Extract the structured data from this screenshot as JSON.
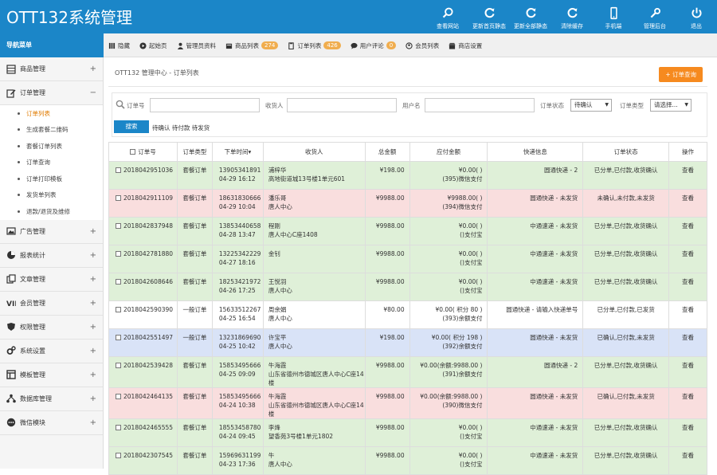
{
  "app": {
    "title": "OTT132系统管理"
  },
  "colors": {
    "primary": "#1b86c8",
    "accent": "#f68a1f",
    "row_green": "#dff0d8",
    "row_red": "#f9dede",
    "row_blue": "#d9e3f7"
  },
  "toolbar": [
    {
      "label": "查看网站",
      "icon": "search-icon"
    },
    {
      "label": "更新首页静态",
      "icon": "refresh-icon"
    },
    {
      "label": "更新全部静态",
      "icon": "refresh-icon"
    },
    {
      "label": "清除缓存",
      "icon": "refresh-icon"
    },
    {
      "label": "手机端",
      "icon": "phone-icon"
    },
    {
      "label": "管理后台",
      "icon": "wrench-icon"
    },
    {
      "label": "退出",
      "icon": "power-icon"
    }
  ],
  "nav": {
    "menu_title": "导航菜单",
    "items": [
      {
        "label": "隐藏",
        "icon": "bars-icon"
      },
      {
        "label": "起始页",
        "icon": "play-icon"
      },
      {
        "label": "管理员资料",
        "icon": "user-icon"
      },
      {
        "label": "商品列表",
        "icon": "box-icon",
        "badge": "274"
      },
      {
        "label": "订单列表",
        "icon": "clipboard-icon",
        "badge": "426"
      },
      {
        "label": "用户评论",
        "icon": "comment-icon",
        "badge": "0"
      },
      {
        "label": "会员列表",
        "icon": "users-icon"
      },
      {
        "label": "商店设置",
        "icon": "shop-icon"
      }
    ]
  },
  "sidebar": {
    "groups": [
      {
        "label": "商品管理",
        "icon": "grid-icon",
        "toggle": "+"
      },
      {
        "label": "订单管理",
        "icon": "edit-icon",
        "toggle": "−"
      }
    ],
    "subitems": [
      "订单列表",
      "生成套餐二维码",
      "套餐订单列表",
      "订单查询",
      "订单打印模板",
      "发货单列表",
      "退款/退货及维修"
    ],
    "groups2": [
      {
        "label": "广告管理",
        "icon": "image-icon",
        "toggle": "+"
      },
      {
        "label": "报表统计",
        "icon": "chart-icon",
        "toggle": "+"
      },
      {
        "label": "文章管理",
        "icon": "copy-icon",
        "toggle": "+"
      },
      {
        "label": "会员管理",
        "icon": "vip-icon",
        "toggle": "+"
      },
      {
        "label": "权限管理",
        "icon": "shield-icon",
        "toggle": "+"
      },
      {
        "label": "系统设置",
        "icon": "gears-icon",
        "toggle": "+"
      },
      {
        "label": "模板管理",
        "icon": "template-icon",
        "toggle": "+"
      },
      {
        "label": "数据库管理",
        "icon": "network-icon",
        "toggle": "+"
      },
      {
        "label": "微信模块",
        "icon": "wechat-icon",
        "toggle": "+"
      }
    ]
  },
  "main": {
    "breadcrumb": "OTT132 管理中心 - 订单列表",
    "query_button": "+ 订单查询",
    "search": {
      "order_no_label": "订单号",
      "receiver_label": "收货人",
      "username_label": "用户名",
      "status_label": "订单状态",
      "status_value": "待确认",
      "type_label": "订单类型",
      "type_value": "请选择...",
      "submit": "搜索",
      "quick": "待确认 待付款 待发货"
    },
    "table": {
      "headers": [
        "订单号",
        "订单类型",
        "下单时间▾",
        "收货人",
        "总金额",
        "应付金额",
        "快递信息",
        "订单状态",
        "操作"
      ],
      "rows": [
        {
          "c": "g",
          "sn": "2018042951036",
          "type": "套餐订单",
          "tel": "13905341891",
          "time": "04-29 16:12",
          "name": "浦梓华",
          "addr": "高地街道城13号楼1单元601",
          "total": "¥198.00",
          "pay1": "¥0.00( )",
          "pay2": "(395)微信支付",
          "exp": "圆通快递 - 2",
          "status": "已分单,已付款,收货确认",
          "op": "查看"
        },
        {
          "c": "r",
          "sn": "2018042911109",
          "type": "套餐订单",
          "tel": "18631830666",
          "time": "04-29 10:04",
          "name": "潘乐哥",
          "addr": "唐人中心",
          "total": "¥9988.00",
          "pay1": "¥9988.00( )",
          "pay2": "(394)微信支付",
          "exp": "圆通快递 - 未发货",
          "status": "未确认,未付款,未发货",
          "op": "查看"
        },
        {
          "c": "g",
          "sn": "2018042837948",
          "type": "套餐订单",
          "tel": "13853440658",
          "time": "04-28 13:47",
          "name": "程刚",
          "addr": "唐人中心C座1408",
          "total": "¥9988.00",
          "pay1": "¥0.00( )",
          "pay2": "()支付宝",
          "exp": "中通速递 - 未发货",
          "status": "已分单,已付款,收货确认",
          "op": "查看"
        },
        {
          "c": "g",
          "sn": "2018042781880",
          "type": "套餐订单",
          "tel": "13225342229",
          "time": "04-27 18:16",
          "name": "金钊",
          "addr": "",
          "total": "¥9988.00",
          "pay1": "¥0.00( )",
          "pay2": "()支付宝",
          "exp": "中通速递 - 未发货",
          "status": "已分单,已付款,收货确认",
          "op": "查看"
        },
        {
          "c": "g",
          "sn": "2018042608646",
          "type": "套餐订单",
          "tel": "18253421972",
          "time": "04-26 17:25",
          "name": "王悦羽",
          "addr": "唐人中心",
          "total": "¥9988.00",
          "pay1": "¥0.00( )",
          "pay2": "()支付宝",
          "exp": "中通速递 - 未发货",
          "status": "已分单,已付款,收货确认",
          "op": "查看"
        },
        {
          "c": "w",
          "sn": "2018042590390",
          "type": "一般订单",
          "tel": "15633512267",
          "time": "04-25 16:54",
          "name": "周余娟",
          "addr": "唐人中心",
          "total": "¥80.00",
          "pay1": "¥0.00( 积分 80 )",
          "pay2": "(393)余额支付",
          "exp": "圆通快递 - 请输入快递单号",
          "status": "已分单,已付款,已发货",
          "op": "查看"
        },
        {
          "c": "b",
          "sn": "2018042551497",
          "type": "一般订单",
          "tel": "13231869690",
          "time": "04-25 10:42",
          "name": "许宝平",
          "addr": "唐人中心",
          "total": "¥198.00",
          "pay1": "¥0.00( 积分 198 )",
          "pay2": "(392)余额支付",
          "exp": "圆通快递 - 未发货",
          "status": "已确认,已付款,未发货",
          "op": "查看"
        },
        {
          "c": "g",
          "sn": "2018042539428",
          "type": "套餐订单",
          "tel": "15853495666",
          "time": "04-25 09:09",
          "name": "牛海霞",
          "addr": "山东省德州市德城区唐人中心C座14楼",
          "total": "¥9988.00",
          "pay1": "¥0.00(余额:9988.00 )",
          "pay2": "(391)余额支付",
          "exp": "圆通快递 - 2",
          "status": "已分单,已付款,收货确认",
          "op": "查看"
        },
        {
          "c": "r",
          "sn": "2018042464135",
          "type": "套餐订单",
          "tel": "15853495666",
          "time": "04-24 10:38",
          "name": "牛海霞",
          "addr": "山东省德州市德城区唐人中心C座14楼",
          "total": "¥9988.00",
          "pay1": "¥0.00(余额:9988.00 )",
          "pay2": "(390)微信支付",
          "exp": "圆通快递 - 未发货",
          "status": "已确认,已付款,未发货",
          "op": "查看"
        },
        {
          "c": "g",
          "sn": "2018042465555",
          "type": "套餐订单",
          "tel": "18553458780",
          "time": "04-24 09:45",
          "name": "李烽",
          "addr": "望香苑3号楼1单元1802",
          "total": "¥9988.00",
          "pay1": "¥0.00( )",
          "pay2": "()支付宝",
          "exp": "中通速递 - 未发货",
          "status": "已分单,已付款,收货确认",
          "op": "查看"
        },
        {
          "c": "g",
          "sn": "2018042307545",
          "type": "套餐订单",
          "tel": "15969631199",
          "time": "04-23 17:36",
          "name": "牛",
          "addr": "唐人中心",
          "total": "¥9988.00",
          "pay1": "¥0.00( )",
          "pay2": "()支付宝",
          "exp": "中通速递 - 未发货",
          "status": "已分单,已付款,收货确认",
          "op": "查看"
        }
      ]
    }
  }
}
